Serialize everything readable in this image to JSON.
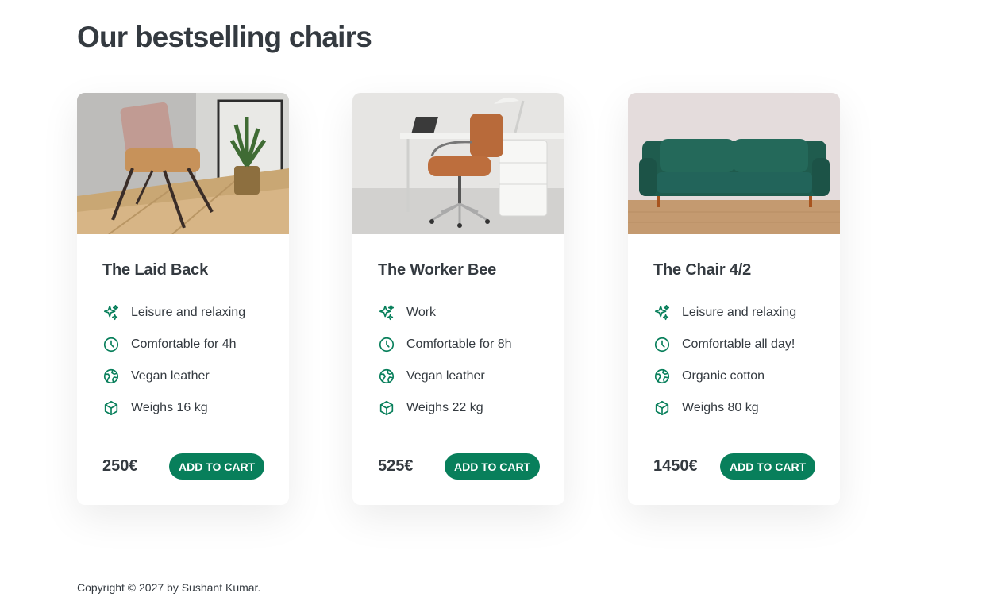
{
  "page": {
    "title": "Our bestselling chairs",
    "footer": "Copyright © 2027 by Sushant Kumar."
  },
  "colors": {
    "accent": "#087f5b",
    "text": "#343a40"
  },
  "cards": [
    {
      "title": "The Laid Back",
      "image": "lounge-chair-photo",
      "attributes": [
        {
          "icon": "sparkles-icon",
          "text": "Leisure and relaxing"
        },
        {
          "icon": "clock-icon",
          "text": "Comfortable for 4h"
        },
        {
          "icon": "globe-icon",
          "text": "Vegan leather"
        },
        {
          "icon": "cube-icon",
          "text": "Weighs 16 kg"
        }
      ],
      "price": "250€",
      "button": "ADD TO CART"
    },
    {
      "title": "The Worker Bee",
      "image": "office-chair-photo",
      "attributes": [
        {
          "icon": "sparkles-icon",
          "text": "Work"
        },
        {
          "icon": "clock-icon",
          "text": "Comfortable for 8h"
        },
        {
          "icon": "globe-icon",
          "text": "Vegan leather"
        },
        {
          "icon": "cube-icon",
          "text": "Weighs 22 kg"
        }
      ],
      "price": "525€",
      "button": "ADD TO CART"
    },
    {
      "title": "The Chair 4/2",
      "image": "green-sofa-photo",
      "attributes": [
        {
          "icon": "sparkles-icon",
          "text": "Leisure and relaxing"
        },
        {
          "icon": "clock-icon",
          "text": "Comfortable all day!"
        },
        {
          "icon": "globe-icon",
          "text": "Organic cotton"
        },
        {
          "icon": "cube-icon",
          "text": "Weighs 80 kg"
        }
      ],
      "price": "1450€",
      "button": "ADD TO CART"
    }
  ]
}
